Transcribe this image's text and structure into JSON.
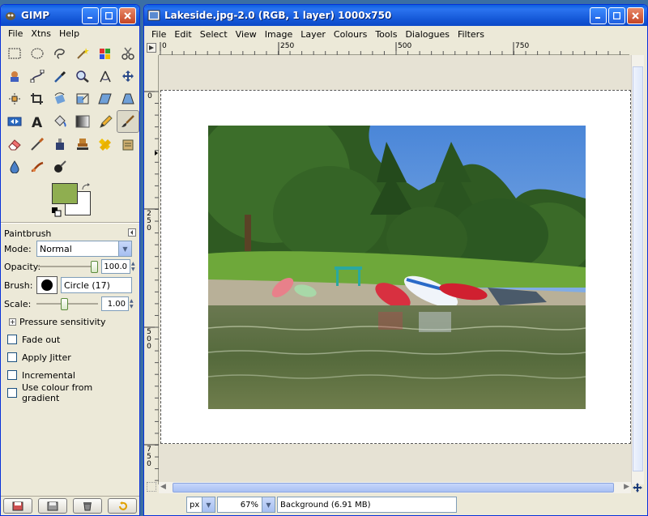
{
  "toolbox": {
    "title": "GIMP",
    "menu": [
      "File",
      "Xtns",
      "Help"
    ],
    "fg_color": "#8fae50",
    "bg_color": "#ffffff",
    "tool_options": {
      "title": "Paintbrush",
      "mode_label": "Mode:",
      "mode_value": "Normal",
      "opacity_label": "Opacity:",
      "opacity_value": "100.0",
      "opacity_level": 1.0,
      "brush_label": "Brush:",
      "brush_value": "Circle (17)",
      "scale_label": "Scale:",
      "scale_value": "1.00",
      "scale_level": 0.45,
      "pressure": "Pressure sensitivity",
      "fade_out": "Fade out",
      "apply_jitter": "Apply Jitter",
      "incremental": "Incremental",
      "use_gradient": "Use colour from gradient"
    }
  },
  "image_window": {
    "title": "Lakeside.jpg-2.0 (RGB, 1 layer) 1000x750",
    "menu": [
      "File",
      "Edit",
      "Select",
      "View",
      "Image",
      "Layer",
      "Colours",
      "Tools",
      "Dialogues",
      "Filters"
    ],
    "ruler_h": [
      "0",
      "250",
      "500",
      "750"
    ],
    "ruler_v": [
      "0",
      "250",
      "500",
      "750"
    ],
    "unit": "px",
    "zoom": "67%",
    "status": "Background (6.91 MB)"
  }
}
